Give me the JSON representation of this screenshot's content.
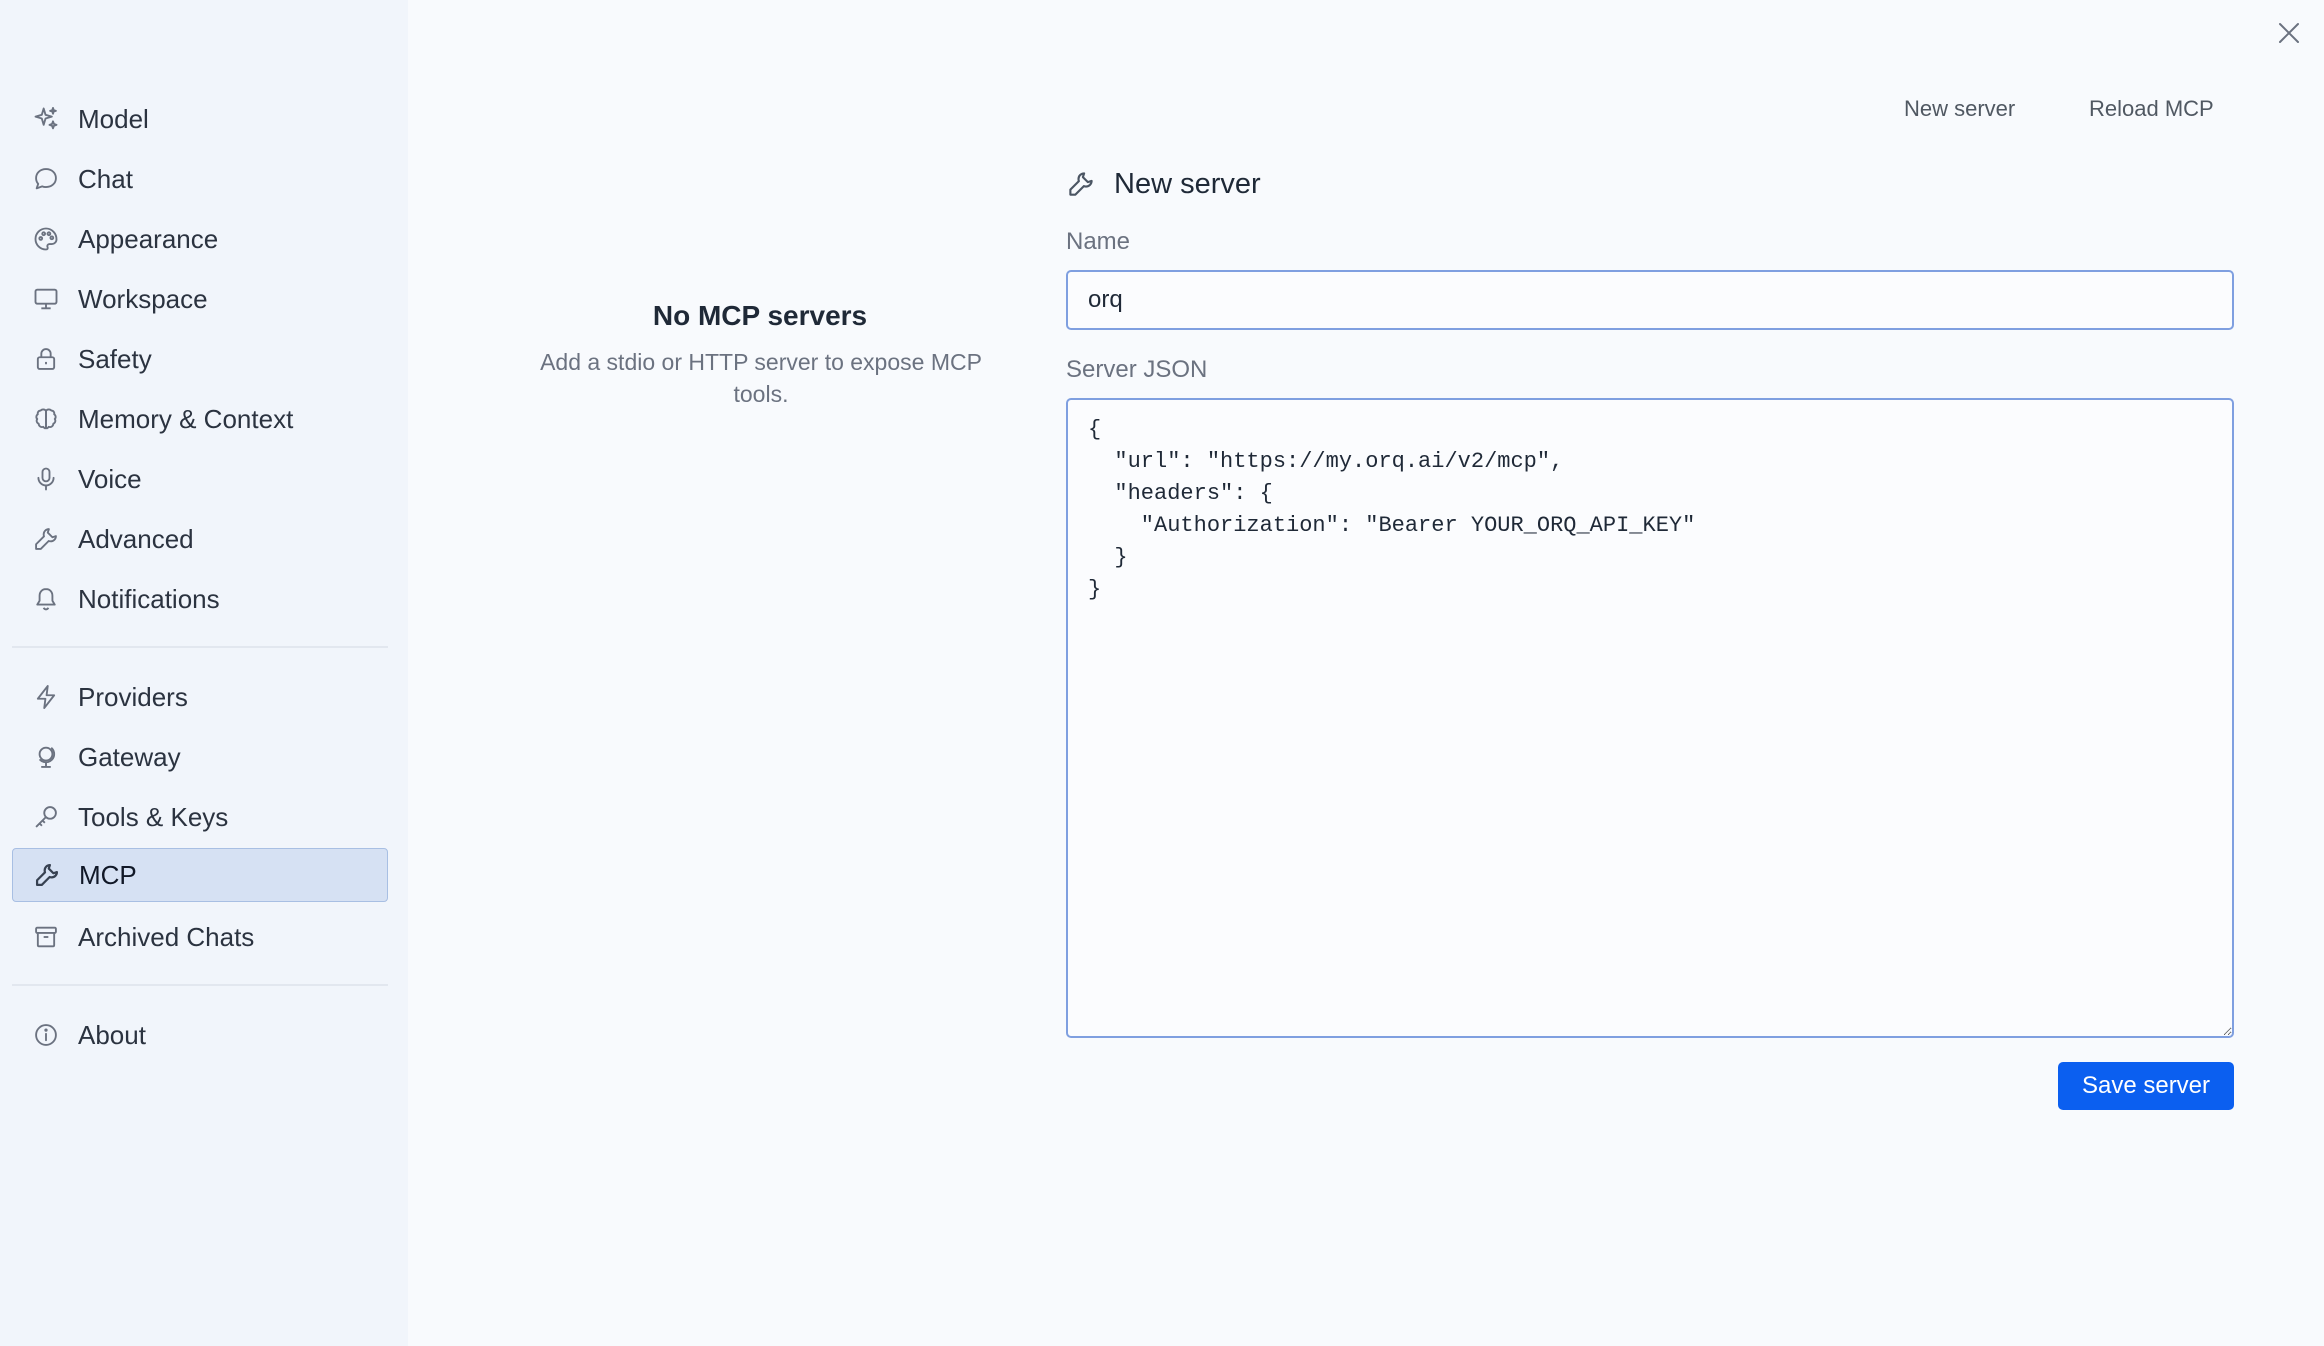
{
  "sidebar": {
    "items": [
      {
        "label": "Model",
        "icon": "sparkles-icon"
      },
      {
        "label": "Chat",
        "icon": "chat-bubble-icon"
      },
      {
        "label": "Appearance",
        "icon": "palette-icon"
      },
      {
        "label": "Workspace",
        "icon": "monitor-icon"
      },
      {
        "label": "Safety",
        "icon": "lock-icon"
      },
      {
        "label": "Memory & Context",
        "icon": "brain-icon"
      },
      {
        "label": "Voice",
        "icon": "microphone-icon"
      },
      {
        "label": "Advanced",
        "icon": "wrench-icon"
      },
      {
        "label": "Notifications",
        "icon": "bell-icon"
      },
      {
        "label": "Providers",
        "icon": "lightning-icon"
      },
      {
        "label": "Gateway",
        "icon": "globe-stand-icon"
      },
      {
        "label": "Tools & Keys",
        "icon": "key-icon"
      },
      {
        "label": "MCP",
        "icon": "wrench-icon",
        "active": true
      },
      {
        "label": "Archived Chats",
        "icon": "archive-box-icon"
      },
      {
        "label": "About",
        "icon": "info-icon"
      }
    ]
  },
  "header": {
    "new_server_label": "New server",
    "reload_mcp_label": "Reload MCP"
  },
  "empty_state": {
    "title": "No MCP servers",
    "description": "Add a stdio or HTTP server to expose MCP tools."
  },
  "form": {
    "title": "New server",
    "icon": "wrench-icon",
    "name_label": "Name",
    "name_value": "orq",
    "json_label": "Server JSON",
    "json_value": "{\n  \"url\": \"https://my.orq.ai/v2/mcp\",\n  \"headers\": {\n    \"Authorization\": \"Bearer YOUR_ORQ_API_KEY\"\n  }\n}",
    "save_label": "Save server"
  },
  "colors": {
    "accent": "#0b5ff0",
    "active_item_bg": "#d6e1f3",
    "input_border": "#7f9fe0"
  }
}
